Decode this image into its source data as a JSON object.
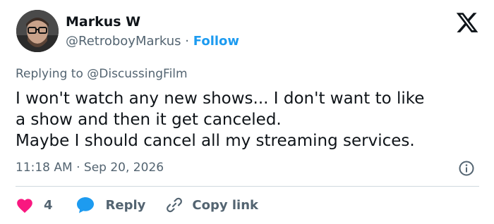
{
  "author": {
    "name": "Markus W",
    "handle": "@RetroboyMarkus",
    "separator": "·",
    "follow_label": "Follow"
  },
  "replying": {
    "prefix": "Replying to",
    "to": "@DiscussingFilm"
  },
  "tweet": {
    "lines": [
      "I won't watch any new shows... I don't want to like",
      "a show and then it get canceled.",
      "Maybe I should cancel all my streaming services."
    ]
  },
  "meta": {
    "time": "11:18 AM",
    "separator": "·",
    "date": "Sep 20, 2026"
  },
  "actions": {
    "like_count": "4",
    "reply_label": "Reply",
    "copy_label": "Copy link"
  },
  "colors": {
    "accent": "#1d9bf0",
    "like": "#f91880",
    "muted": "#536471",
    "text": "#0f1419"
  },
  "icons": {
    "brand": "x-logo-icon",
    "info": "info-icon",
    "like": "heart-icon",
    "reply": "chat-bubble-icon",
    "copy": "link-icon"
  }
}
